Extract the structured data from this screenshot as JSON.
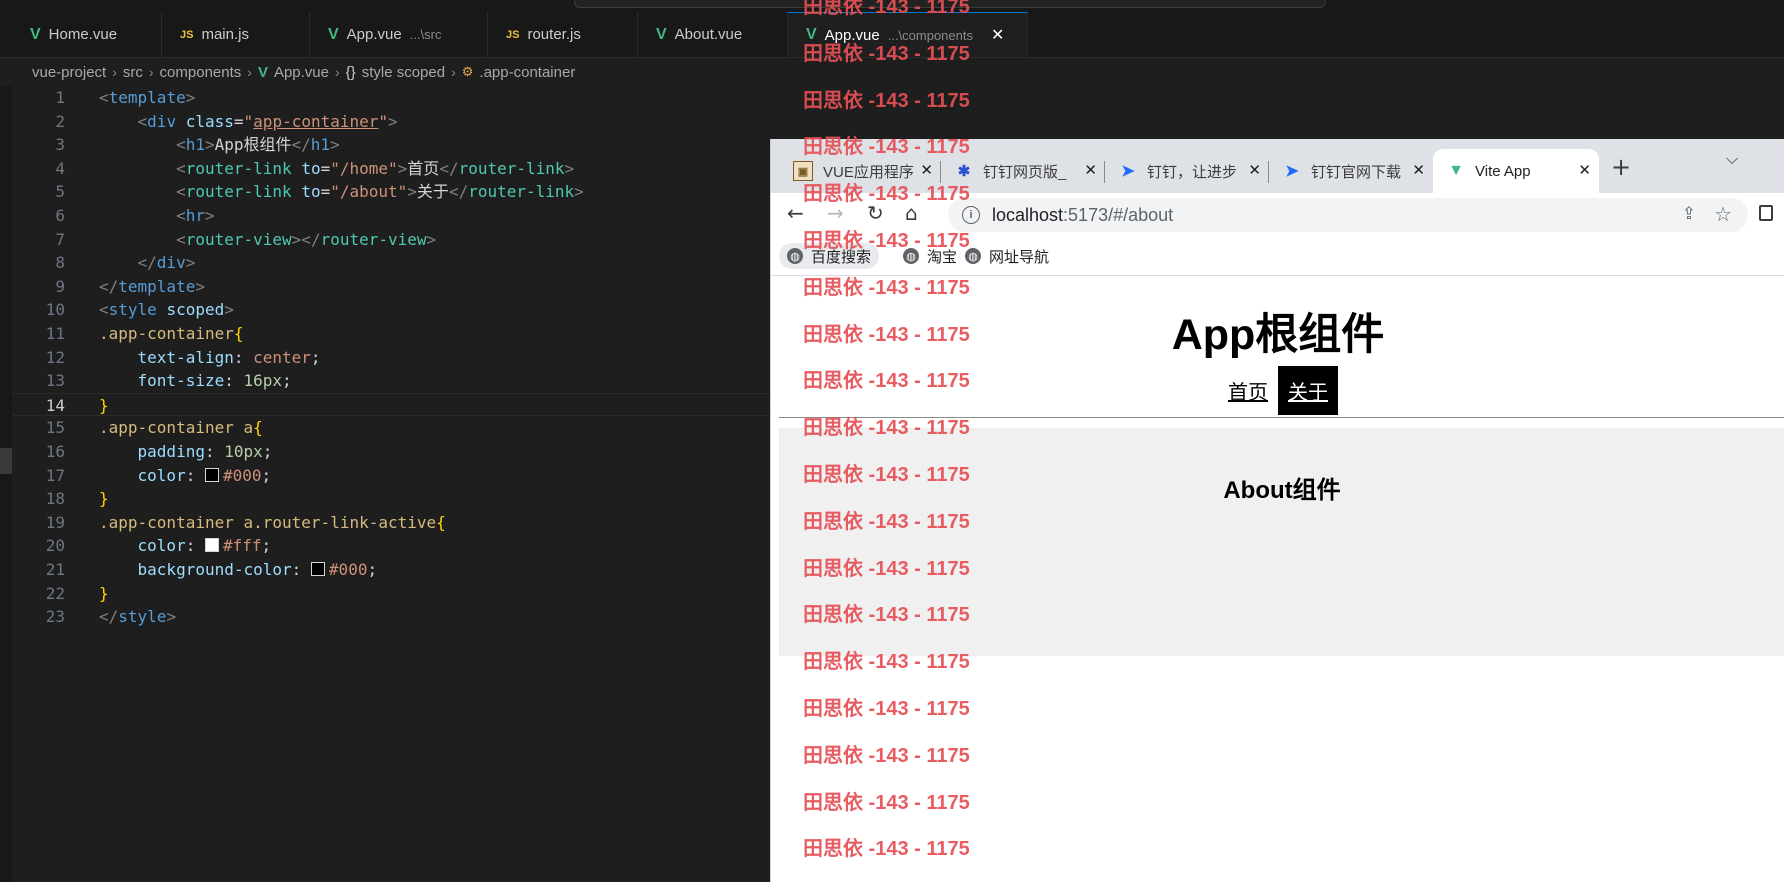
{
  "editor": {
    "tabs": [
      {
        "icon": "vue",
        "name": "Home.vue",
        "sub": "",
        "active": false
      },
      {
        "icon": "js",
        "name": "main.js",
        "sub": "",
        "active": false
      },
      {
        "icon": "vue",
        "name": "App.vue",
        "sub": "...\\src",
        "active": false
      },
      {
        "icon": "js",
        "name": "router.js",
        "sub": "",
        "active": false
      },
      {
        "icon": "vue",
        "name": "About.vue",
        "sub": "",
        "active": false
      },
      {
        "icon": "vue",
        "name": "App.vue",
        "sub": "...\\components",
        "active": true
      }
    ],
    "breadcrumb": [
      "vue-project",
      "src",
      "components",
      "App.vue",
      "style scoped",
      ".app-container"
    ],
    "current_line": 14,
    "lines": [
      "<template>",
      "    <div class=\"app-container\">",
      "        <h1>App根组件</h1>",
      "        <router-link to=\"/home\">首页</router-link>",
      "        <router-link to=\"/about\">关于</router-link>",
      "        <hr>",
      "        <router-view></router-view>",
      "    </div>",
      "</template>",
      "<style scoped>",
      ".app-container{",
      "    text-align: center;",
      "    font-size: 16px;",
      "}",
      ".app-container a{",
      "    padding: 10px;",
      "    color: #000;",
      "}",
      ".app-container a.router-link-active{",
      "    color: #fff;",
      "    background-color: #000;",
      "}",
      "</style>"
    ]
  },
  "browser": {
    "tabs": [
      {
        "icon": "img",
        "title": "VUE应用程序",
        "active": false
      },
      {
        "icon": "paw",
        "title": "钉钉网页版_",
        "active": false
      },
      {
        "icon": "ding",
        "title": "钉钉，让进步",
        "active": false
      },
      {
        "icon": "ding",
        "title": "钉钉官网下载",
        "active": false
      },
      {
        "icon": "vite",
        "title": "Vite App",
        "active": true
      }
    ],
    "url_host": "localhost",
    "url_rest": ":5173/#/about",
    "bookmarks": [
      "百度搜索",
      "淘宝",
      "网址导航"
    ],
    "page": {
      "title": "App根组件",
      "links": [
        "首页",
        "关于"
      ],
      "active_link": "关于",
      "about_title": "About组件"
    }
  },
  "watermark": {
    "text": "田思依 -143 - 1175",
    "color": "#e65055",
    "count": 19
  }
}
